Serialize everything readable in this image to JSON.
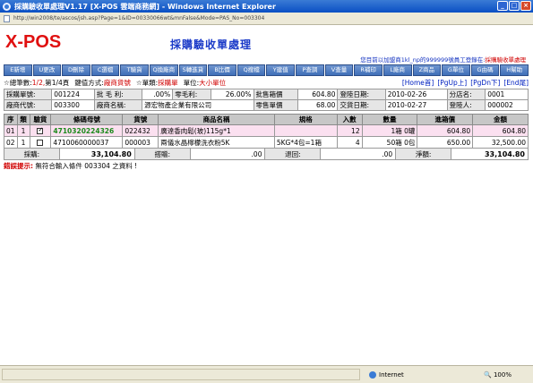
{
  "window": {
    "title": "採購驗收單處理V1.17 [X-POS 雲端商務網] - Windows Internet Explorer",
    "min": "_",
    "max": "□",
    "close": "×"
  },
  "address": {
    "url": "http://win2008/te/ascos/jsh.asp?Page=1&ID=00330066wt&mnFalse&Mode=PAS_No=003304"
  },
  "logo": "X-POS",
  "page_title": "採購驗收單處理",
  "user_line": {
    "prefix": "您目前以加盟商1kl_np的999999號員工登錄在:",
    "suffix": "採購驗收單處理"
  },
  "toolbar": [
    "E新增",
    "U更改",
    "D刪除",
    "C選檔",
    "T驗貨",
    "Q換廠商",
    "S轉進貨",
    "B比價",
    "Q搜檔",
    "Y建值",
    "P查調",
    "V查量",
    "R補印",
    "L廠商",
    "Z商品",
    "G單位",
    "G由碼",
    "H幫助"
  ],
  "info1": {
    "total_label": "☆總筆數:",
    "total_value": "1/2,",
    "page_label": "第1/4頁",
    "key_label": "鍵值方式:",
    "key_value": "廠商貨號",
    "type_label": "☆單類:",
    "type_value": "採購單",
    "unit_label": "單位:",
    "unit_value": "大小單位",
    "nav": [
      "[Home首]",
      "[PgUp上]",
      "[PgDn下]",
      "[End尾]"
    ]
  },
  "header": {
    "row1": [
      {
        "label": "採購單號:",
        "value": "001224"
      },
      {
        "label": "批 毛 利:",
        "value": ".00%"
      },
      {
        "label": "零毛利:",
        "value": "26.00%"
      },
      {
        "label": "批售箱價",
        "value": "604.80"
      },
      {
        "label": "登陸日期:",
        "value": "2010-02-26"
      },
      {
        "label": "分店名:",
        "value": "0001"
      }
    ],
    "row2": [
      {
        "label": "廠商代號:",
        "value": "003300"
      },
      {
        "label": "廠商名稱:",
        "value": "源宏物產企業有限公司"
      },
      {
        "label": "零售單價",
        "value": "68.00"
      },
      {
        "label": "交貨日期:",
        "value": "2010-02-27"
      },
      {
        "label": "登陸人:",
        "value": "000002"
      }
    ]
  },
  "grid": {
    "columns": [
      "序",
      "類",
      "驗貨",
      "條碼母號",
      "貨號",
      "商品名稱",
      "規格",
      "入數",
      "數量",
      "進箱價",
      "金額"
    ],
    "rows": [
      {
        "seq": "01",
        "type": "1",
        "checked": true,
        "barcode": "4710320224326",
        "code": "022432",
        "name": "廣達香肉鬆(玻)115g*1",
        "spec": "",
        "pack": "12",
        "qty_text": "1箱 0罐",
        "qty": "",
        "cost": "604.80",
        "amount": "604.80"
      },
      {
        "seq": "02",
        "type": "1",
        "checked": false,
        "barcode": "4710060000037",
        "code": "000003",
        "name": "兩儀水晶檸檬洗衣粉5K",
        "spec": "5KG*4包=1箱",
        "pack": "4",
        "qty_text": "50箱 0包",
        "qty": "",
        "cost": "650.00",
        "amount": "32,500.00"
      }
    ]
  },
  "totals": {
    "purchase_label": "採購:",
    "purchase_value": "33,104.80",
    "discount_label": "搭贈:",
    "discount_value": ".00",
    "return_label": "退回:",
    "return_value": ".00",
    "net_label": "淨額:",
    "net_value": "33,104.80"
  },
  "error": {
    "label": "錯誤提示:",
    "message": "無符合輸入條件 003304 之資料 !"
  },
  "status": {
    "zone": "Internet",
    "zoom": "100%"
  }
}
